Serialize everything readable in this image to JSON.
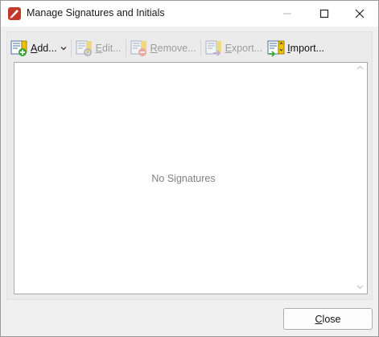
{
  "window": {
    "title": "Manage Signatures and Initials"
  },
  "toolbar": {
    "add": {
      "mnemonic": "A",
      "rest": "dd...",
      "enabled": true,
      "icon": "signature-add-icon"
    },
    "edit": {
      "mnemonic": "E",
      "rest": "dit...",
      "enabled": false,
      "icon": "signature-edit-icon"
    },
    "remove": {
      "mnemonic": "R",
      "rest": "emove...",
      "enabled": false,
      "icon": "signature-remove-icon"
    },
    "export": {
      "mnemonic": "E",
      "rest": "xport...",
      "enabled": false,
      "icon": "signature-export-icon"
    },
    "import": {
      "mnemonic": "I",
      "rest": "mport...",
      "enabled": true,
      "icon": "signature-import-icon"
    }
  },
  "list": {
    "empty_text": "No Signatures"
  },
  "footer": {
    "close_mnemonic": "C",
    "close_rest": "lose"
  },
  "colors": {
    "accent_red": "#c0392b",
    "add_green": "#3aa63a",
    "remove_red": "#e05a4a",
    "import_yellow": "#f2c200",
    "export_purple": "#8a5cc4"
  }
}
